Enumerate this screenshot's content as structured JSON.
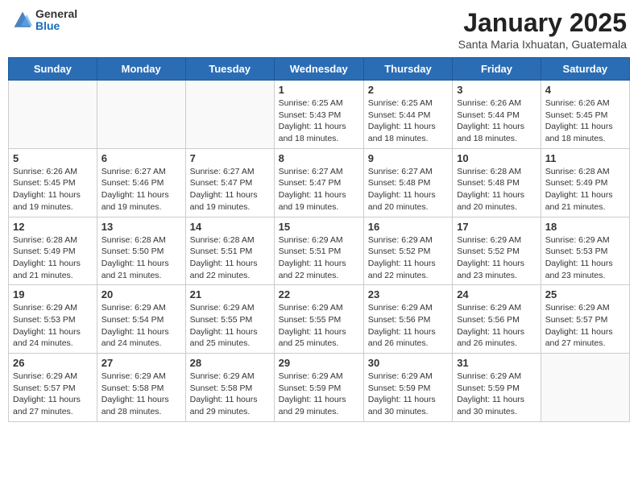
{
  "header": {
    "logo_general": "General",
    "logo_blue": "Blue",
    "month_title": "January 2025",
    "subtitle": "Santa Maria Ixhuatan, Guatemala"
  },
  "weekdays": [
    "Sunday",
    "Monday",
    "Tuesday",
    "Wednesday",
    "Thursday",
    "Friday",
    "Saturday"
  ],
  "weeks": [
    [
      {
        "day": "",
        "info": ""
      },
      {
        "day": "",
        "info": ""
      },
      {
        "day": "",
        "info": ""
      },
      {
        "day": "1",
        "info": "Sunrise: 6:25 AM\nSunset: 5:43 PM\nDaylight: 11 hours and 18 minutes."
      },
      {
        "day": "2",
        "info": "Sunrise: 6:25 AM\nSunset: 5:44 PM\nDaylight: 11 hours and 18 minutes."
      },
      {
        "day": "3",
        "info": "Sunrise: 6:26 AM\nSunset: 5:44 PM\nDaylight: 11 hours and 18 minutes."
      },
      {
        "day": "4",
        "info": "Sunrise: 6:26 AM\nSunset: 5:45 PM\nDaylight: 11 hours and 18 minutes."
      }
    ],
    [
      {
        "day": "5",
        "info": "Sunrise: 6:26 AM\nSunset: 5:45 PM\nDaylight: 11 hours and 19 minutes."
      },
      {
        "day": "6",
        "info": "Sunrise: 6:27 AM\nSunset: 5:46 PM\nDaylight: 11 hours and 19 minutes."
      },
      {
        "day": "7",
        "info": "Sunrise: 6:27 AM\nSunset: 5:47 PM\nDaylight: 11 hours and 19 minutes."
      },
      {
        "day": "8",
        "info": "Sunrise: 6:27 AM\nSunset: 5:47 PM\nDaylight: 11 hours and 19 minutes."
      },
      {
        "day": "9",
        "info": "Sunrise: 6:27 AM\nSunset: 5:48 PM\nDaylight: 11 hours and 20 minutes."
      },
      {
        "day": "10",
        "info": "Sunrise: 6:28 AM\nSunset: 5:48 PM\nDaylight: 11 hours and 20 minutes."
      },
      {
        "day": "11",
        "info": "Sunrise: 6:28 AM\nSunset: 5:49 PM\nDaylight: 11 hours and 21 minutes."
      }
    ],
    [
      {
        "day": "12",
        "info": "Sunrise: 6:28 AM\nSunset: 5:49 PM\nDaylight: 11 hours and 21 minutes."
      },
      {
        "day": "13",
        "info": "Sunrise: 6:28 AM\nSunset: 5:50 PM\nDaylight: 11 hours and 21 minutes."
      },
      {
        "day": "14",
        "info": "Sunrise: 6:28 AM\nSunset: 5:51 PM\nDaylight: 11 hours and 22 minutes."
      },
      {
        "day": "15",
        "info": "Sunrise: 6:29 AM\nSunset: 5:51 PM\nDaylight: 11 hours and 22 minutes."
      },
      {
        "day": "16",
        "info": "Sunrise: 6:29 AM\nSunset: 5:52 PM\nDaylight: 11 hours and 22 minutes."
      },
      {
        "day": "17",
        "info": "Sunrise: 6:29 AM\nSunset: 5:52 PM\nDaylight: 11 hours and 23 minutes."
      },
      {
        "day": "18",
        "info": "Sunrise: 6:29 AM\nSunset: 5:53 PM\nDaylight: 11 hours and 23 minutes."
      }
    ],
    [
      {
        "day": "19",
        "info": "Sunrise: 6:29 AM\nSunset: 5:53 PM\nDaylight: 11 hours and 24 minutes."
      },
      {
        "day": "20",
        "info": "Sunrise: 6:29 AM\nSunset: 5:54 PM\nDaylight: 11 hours and 24 minutes."
      },
      {
        "day": "21",
        "info": "Sunrise: 6:29 AM\nSunset: 5:55 PM\nDaylight: 11 hours and 25 minutes."
      },
      {
        "day": "22",
        "info": "Sunrise: 6:29 AM\nSunset: 5:55 PM\nDaylight: 11 hours and 25 minutes."
      },
      {
        "day": "23",
        "info": "Sunrise: 6:29 AM\nSunset: 5:56 PM\nDaylight: 11 hours and 26 minutes."
      },
      {
        "day": "24",
        "info": "Sunrise: 6:29 AM\nSunset: 5:56 PM\nDaylight: 11 hours and 26 minutes."
      },
      {
        "day": "25",
        "info": "Sunrise: 6:29 AM\nSunset: 5:57 PM\nDaylight: 11 hours and 27 minutes."
      }
    ],
    [
      {
        "day": "26",
        "info": "Sunrise: 6:29 AM\nSunset: 5:57 PM\nDaylight: 11 hours and 27 minutes."
      },
      {
        "day": "27",
        "info": "Sunrise: 6:29 AM\nSunset: 5:58 PM\nDaylight: 11 hours and 28 minutes."
      },
      {
        "day": "28",
        "info": "Sunrise: 6:29 AM\nSunset: 5:58 PM\nDaylight: 11 hours and 29 minutes."
      },
      {
        "day": "29",
        "info": "Sunrise: 6:29 AM\nSunset: 5:59 PM\nDaylight: 11 hours and 29 minutes."
      },
      {
        "day": "30",
        "info": "Sunrise: 6:29 AM\nSunset: 5:59 PM\nDaylight: 11 hours and 30 minutes."
      },
      {
        "day": "31",
        "info": "Sunrise: 6:29 AM\nSunset: 5:59 PM\nDaylight: 11 hours and 30 minutes."
      },
      {
        "day": "",
        "info": ""
      }
    ]
  ]
}
